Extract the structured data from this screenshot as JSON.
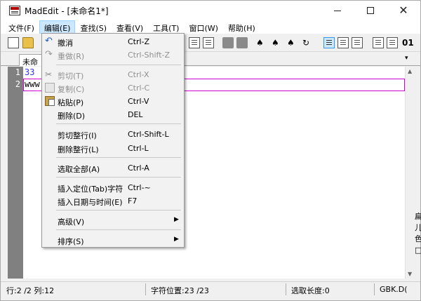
{
  "window": {
    "title": "MadEdit - [未命名1*]",
    "minimize_glyph": "",
    "maximize_glyph": "",
    "close_glyph": "✕"
  },
  "menubar": [
    {
      "label": "文件(F)"
    },
    {
      "label": "编辑(E)",
      "active": true
    },
    {
      "label": "查找(S)"
    },
    {
      "label": "查看(V)"
    },
    {
      "label": "工具(T)"
    },
    {
      "label": "窗口(W)"
    },
    {
      "label": "帮助(H)"
    }
  ],
  "toolbar": {
    "icons": [
      "new-file-icon",
      "open-folder-icon",
      "find-icon",
      "find-next-icon",
      "find-prev-icon",
      "replace-icon",
      "text-mode-icon",
      "column-mode-icon",
      "hex-mode-icon",
      "word-wrap-icon",
      "binary-icon"
    ],
    "binary_label": "01"
  },
  "tabs": {
    "active_label": "未命",
    "dropdown_glyph": "▾"
  },
  "editor": {
    "lines": [
      {
        "number": "1",
        "text": "33"
      },
      {
        "number": "2",
        "text": "www"
      }
    ],
    "current_line_color": "#d000d0"
  },
  "edit_menu": {
    "items": [
      {
        "label": "撤消",
        "shortcut": "Ctrl-Z",
        "enabled": true,
        "icon": "undo-icon"
      },
      {
        "label": "重做(R)",
        "shortcut": "Ctrl-Shift-Z",
        "enabled": false,
        "icon": "redo-icon"
      },
      {
        "label": "剪切(T)",
        "shortcut": "Ctrl-X",
        "enabled": false,
        "icon": "cut-icon"
      },
      {
        "label": "复制(C)",
        "shortcut": "Ctrl-C",
        "enabled": false,
        "icon": "copy-icon"
      },
      {
        "label": "粘贴(P)",
        "shortcut": "Ctrl-V",
        "enabled": true,
        "icon": "paste-icon"
      },
      {
        "label": "删除(D)",
        "shortcut": "DEL",
        "enabled": true
      },
      {
        "label": "剪切整行(I)",
        "shortcut": "Ctrl-Shift-L",
        "enabled": true
      },
      {
        "label": "删除整行(L)",
        "shortcut": "Ctrl-L",
        "enabled": true
      },
      {
        "label": "选取全部(A)",
        "shortcut": "Ctrl-A",
        "enabled": true
      },
      {
        "label": "插入定位(Tab)字符",
        "shortcut": "Ctrl-~",
        "enabled": true
      },
      {
        "label": "插入日期与时间(E)",
        "shortcut": "F7",
        "enabled": true
      },
      {
        "label": "高级(V)",
        "shortcut": "",
        "enabled": true,
        "submenu": true
      },
      {
        "label": "排序(S)",
        "shortcut": "",
        "enabled": true,
        "submenu": true
      }
    ],
    "submenu_arrow": "▶"
  },
  "statusbar": {
    "line_col": "行:2 /2 列:12",
    "char_pos": "字符位置:23 /23",
    "selection": "选取长度:0",
    "encoding": "GBK.D("
  },
  "clipped_right": {
    "line1": "扁",
    "line2": "儿",
    "line3": "色",
    "line4": "□"
  },
  "colors": {
    "menu_highlight": "#cce8ff",
    "gutter": "#808080",
    "line1_text": "#3333ff"
  }
}
